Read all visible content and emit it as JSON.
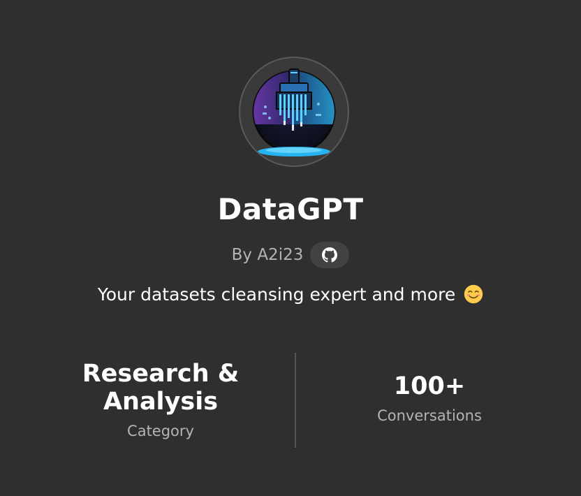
{
  "gpt": {
    "name": "DataGPT",
    "author_prefix": "By A2i23",
    "description": "Your datasets cleansing expert and more",
    "description_emoji": "😊"
  },
  "icons": {
    "avatar": "paintbrush-circuit-logo",
    "social": "github-icon"
  },
  "stats": {
    "category": {
      "value_line1": "Research &",
      "value_line2": "Analysis",
      "label": "Category"
    },
    "conversations": {
      "value": "100+",
      "label": "Conversations"
    }
  },
  "colors": {
    "background": "#2f2f2f",
    "muted_text": "#b4b4b4",
    "pill_background": "#424242",
    "divider": "#555555"
  }
}
